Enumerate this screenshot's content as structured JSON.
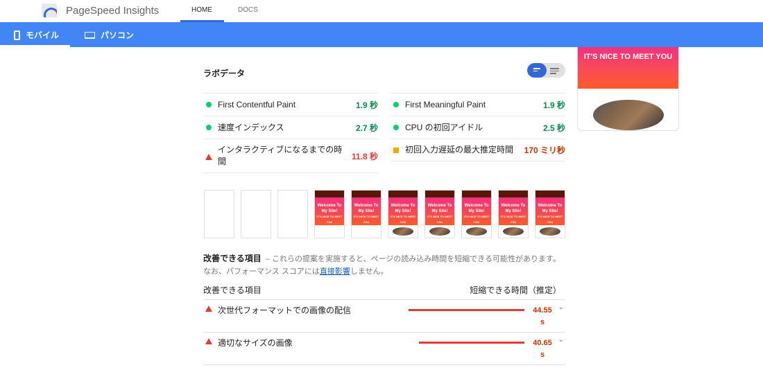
{
  "header": {
    "brand": "PageSpeed Insights",
    "nav": [
      "HOME",
      "DOCS"
    ]
  },
  "device_tabs": [
    {
      "label": "モバイル",
      "icon": "phone-icon"
    },
    {
      "label": "パソコン",
      "icon": "laptop-icon"
    }
  ],
  "preview": {
    "headline": "IT'S NICE TO MEET YOU"
  },
  "lab": {
    "title": "ラボデータ",
    "metrics": [
      {
        "name": "First Contentful Paint",
        "value": "1.9 秒",
        "status": "good"
      },
      {
        "name": "First Meaningful Paint",
        "value": "1.9 秒",
        "status": "good"
      },
      {
        "name": "速度インデックス",
        "value": "2.7 秒",
        "status": "good"
      },
      {
        "name": "CPU の初回アイドル",
        "value": "2.5 秒",
        "status": "good"
      },
      {
        "name": "インタラクティブになるまでの時間",
        "value": "11.8 秒",
        "status": "poor"
      },
      {
        "name": "初回入力遅延の最大推定時間",
        "value": "170 ミリ秒",
        "status": "average"
      }
    ]
  },
  "filmstrip": {
    "frame_title": "Welcome To My Site!",
    "frame_sub": "IT'S NICE TO MEET YOU"
  },
  "opportunities": {
    "title": "改善できる項目",
    "desc_before": "– これらの提案を実施すると、ページの読み込み時間を短縮できる可能性があります。なお、パフォーマンス スコアには",
    "link": "直接影響",
    "desc_after": "しません。",
    "col_item": "改善できる項目",
    "col_savings": "短縮できる時間（推定）",
    "rows": [
      {
        "name": "次世代フォーマットでの画像の配信",
        "value": "44.55 s",
        "fraction": 1.0
      },
      {
        "name": "適切なサイズの画像",
        "value": "40.65 s",
        "fraction": 0.91
      }
    ]
  }
}
